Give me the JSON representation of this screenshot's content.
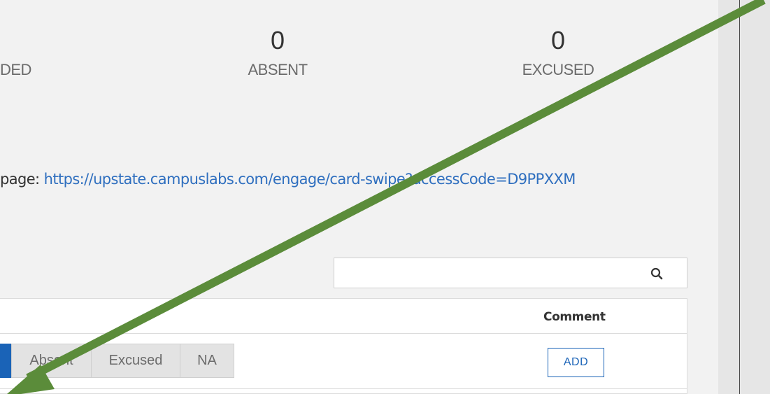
{
  "stats": [
    {
      "count": "",
      "label": "DED"
    },
    {
      "count": "0",
      "label": "ABSENT"
    },
    {
      "count": "0",
      "label": "EXCUSED"
    }
  ],
  "access": {
    "prefix": "page: ",
    "url": "https://upstate.campuslabs.com/engage/card-swipe?accessCode=D9PPXXM"
  },
  "search": {
    "placeholder": "",
    "icon": "search-icon"
  },
  "table": {
    "columns": {
      "comment": "Comment"
    },
    "row": {
      "attendance_options": [
        "Absent",
        "Excused",
        "NA"
      ],
      "add_label": "ADD"
    }
  },
  "colors": {
    "accent": "#1a63b7",
    "arrow": "#5b8c3a",
    "link": "#2f6fbf"
  }
}
